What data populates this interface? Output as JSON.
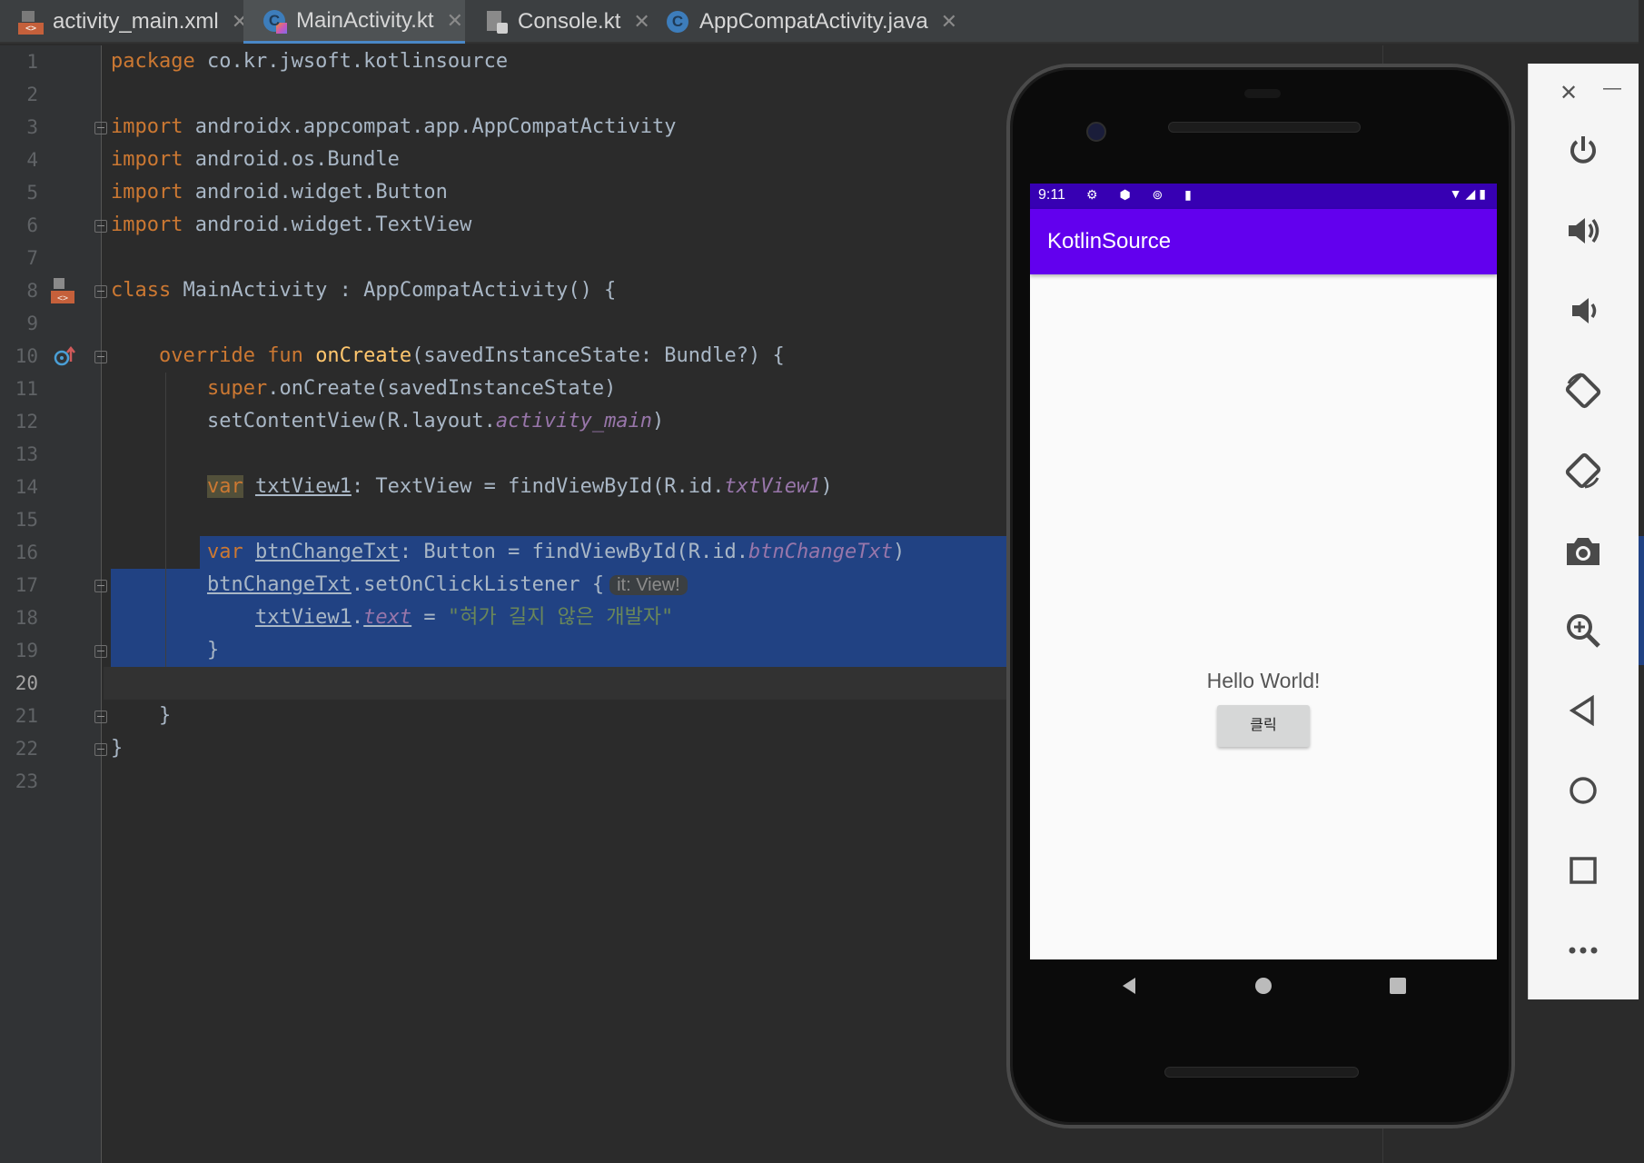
{
  "tabs": [
    {
      "label": "activity_main.xml",
      "icon": "xml-file-icon"
    },
    {
      "label": "MainActivity.kt",
      "icon": "kotlin-class-icon",
      "active": true
    },
    {
      "label": "Console.kt",
      "icon": "file-icon"
    },
    {
      "label": "AppCompatActivity.java",
      "icon": "java-class-icon"
    }
  ],
  "editor": {
    "current_line": 20,
    "lines": [
      {
        "n": "1"
      },
      {
        "n": "2"
      },
      {
        "n": "3"
      },
      {
        "n": "4"
      },
      {
        "n": "5"
      },
      {
        "n": "6"
      },
      {
        "n": "7"
      },
      {
        "n": "8"
      },
      {
        "n": "9"
      },
      {
        "n": "10"
      },
      {
        "n": "11"
      },
      {
        "n": "12"
      },
      {
        "n": "13"
      },
      {
        "n": "14"
      },
      {
        "n": "15"
      },
      {
        "n": "16"
      },
      {
        "n": "17"
      },
      {
        "n": "18"
      },
      {
        "n": "19"
      },
      {
        "n": "20"
      },
      {
        "n": "21"
      },
      {
        "n": "22"
      },
      {
        "n": "23"
      }
    ],
    "code": {
      "l1_kw": "package",
      "l1_rest": " co.kr.jwsoft.kotlinsource",
      "import_kw": "import",
      "l3_rest": " androidx.appcompat.app.AppCompatActivity",
      "l4_rest": " android.os.Bundle",
      "l5_rest": " android.widget.Button",
      "l6_rest": " android.widget.TextView",
      "l8_kw": "class",
      "l8_rest": " MainActivity : AppCompatActivity() {",
      "l10_kw": "override fun",
      "l10_fn": "onCreate",
      "l10_rest": "(savedInstanceState: Bundle?) {",
      "l11_kw": "super",
      "l11_rest": ".onCreate(savedInstanceState)",
      "l12_a": "setContentView(R.layout.",
      "l12_prop": "activity_main",
      "l12_b": ")",
      "var_kw": "var",
      "l14_name": "txtView1",
      "l14_a": ": TextView = findViewById(R.id.",
      "l14_prop": "txtView1",
      "l14_b": ")",
      "l16_name": "btnChangeTxt",
      "l16_a": ": Button = findViewById(R.id.",
      "l16_prop": "btnChangeTxt",
      "l16_b": ")",
      "l17_name": "btnChangeTxt",
      "l17_a": ".setOnClickListener {",
      "l17_hint": "it: View!",
      "l18_name": "txtView1",
      "l18_dot": ".",
      "l18_prop": "text",
      "l18_eq": " = ",
      "l18_str": "\"혀가 길지 않은 개발자\"",
      "close_brace": "}"
    }
  },
  "emulator": {
    "status_time": "9:11",
    "status_left_icons": "⚙ ⬢ ⊚ ▮",
    "status_right_icons": "▼◢▮",
    "app_title": "KotlinSource",
    "hello_text": "Hello World!",
    "button_label": "클릭",
    "nav": [
      "back-icon",
      "home-icon",
      "recents-icon"
    ]
  },
  "sidebar": {
    "close_glyph": "✕",
    "minimize_glyph": "—",
    "buttons": [
      "power-icon",
      "volume-up-icon",
      "volume-down-icon",
      "rotate-left-icon",
      "rotate-right-icon",
      "camera-icon",
      "zoom-icon",
      "back-icon",
      "home-icon",
      "overview-icon",
      "more-icon"
    ]
  },
  "colors": {
    "editor_bg": "#2b2b2b",
    "keyword": "#cc7832",
    "function": "#ffc66d",
    "string": "#6a8759",
    "property": "#9876aa",
    "selection": "#214283",
    "app_primary": "#6200ee",
    "status_bar": "#3700b3"
  }
}
